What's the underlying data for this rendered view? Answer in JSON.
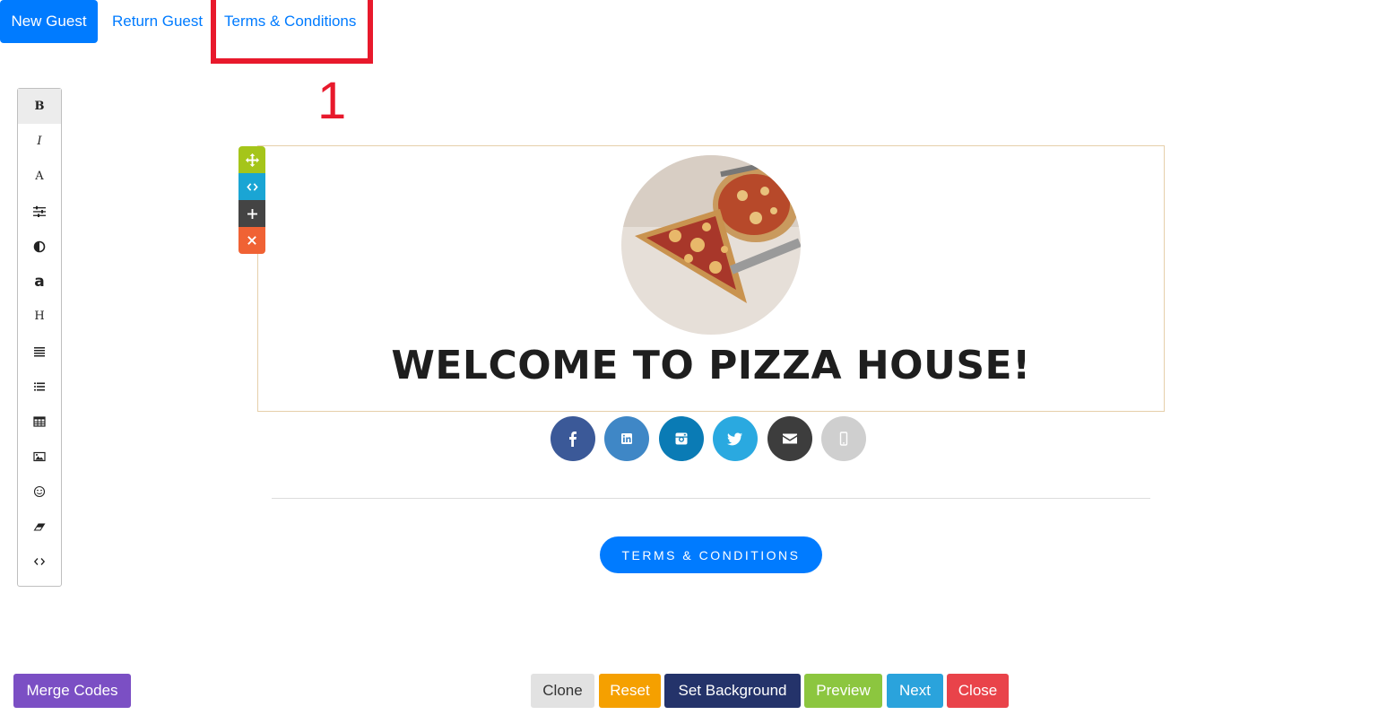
{
  "tabs": {
    "new_guest": "New Guest",
    "return_guest": "Return Guest",
    "terms": "Terms & Conditions"
  },
  "annotation": {
    "number": "1",
    "color": "#e8192c"
  },
  "toolbar": {
    "items": [
      {
        "name": "bold",
        "label": "B"
      },
      {
        "name": "italic",
        "label": "I"
      },
      {
        "name": "font",
        "label": "A"
      },
      {
        "name": "sliders-icon",
        "label": ""
      },
      {
        "name": "contrast-icon",
        "label": ""
      },
      {
        "name": "font-size",
        "label": "a"
      },
      {
        "name": "heading",
        "label": "H"
      },
      {
        "name": "align-icon",
        "label": ""
      },
      {
        "name": "list-icon",
        "label": ""
      },
      {
        "name": "table-icon",
        "label": ""
      },
      {
        "name": "image-icon",
        "label": ""
      },
      {
        "name": "smiley-icon",
        "label": ""
      },
      {
        "name": "eraser-icon",
        "label": ""
      },
      {
        "name": "code-icon",
        "label": ""
      }
    ]
  },
  "block_handles": [
    "move-icon",
    "code-icon",
    "plus-icon",
    "close-icon"
  ],
  "headline": "WELCOME TO PIZZA HOUSE!",
  "social": [
    {
      "name": "facebook-icon",
      "color": "#3b5998"
    },
    {
      "name": "linkedin-icon",
      "color": "#3f87c6"
    },
    {
      "name": "instagram-icon",
      "color": "#0a7bb5"
    },
    {
      "name": "twitter-icon",
      "color": "#2aa9e0"
    },
    {
      "name": "email-icon",
      "color": "#3d3d3d"
    },
    {
      "name": "phone-icon",
      "color": "#cfcfcf"
    }
  ],
  "terms_button": "TERMS & CONDITIONS",
  "footer": {
    "merge_codes": "Merge Codes",
    "clone": "Clone",
    "reset": "Reset",
    "set_background": "Set Background",
    "preview": "Preview",
    "next": "Next",
    "close": "Close"
  },
  "colors": {
    "primary": "#007bff",
    "merge": "#7b4fc4",
    "clone": "#e2e2e2",
    "reset": "#f5a000",
    "background": "#24336a",
    "preview": "#8cc63f",
    "next": "#2aa3dc",
    "close": "#e9434a"
  }
}
